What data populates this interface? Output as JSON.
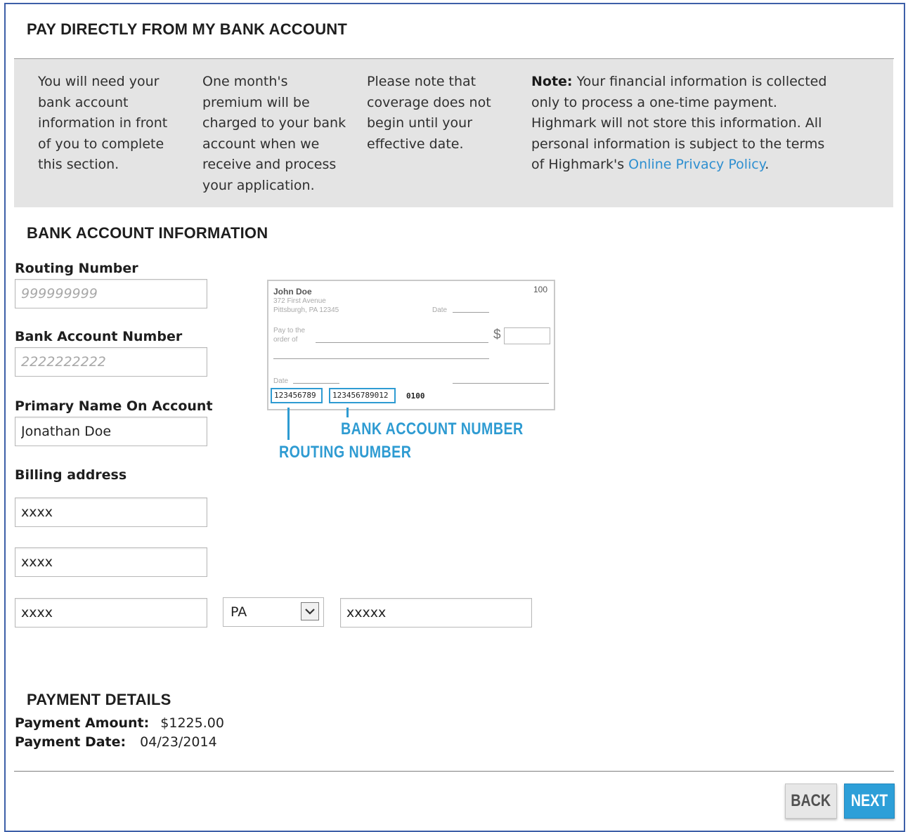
{
  "header": {
    "title": "PAY DIRECTLY FROM MY BANK ACCOUNT"
  },
  "info": {
    "col1": [
      "You will need your",
      "bank account",
      "information in front",
      "of you to complete",
      "this section."
    ],
    "col2": [
      "One month's",
      "premium will be",
      "charged to your bank",
      "account when we",
      "receive and process",
      "your application."
    ],
    "col3": [
      "Please note that",
      "coverage does not",
      "begin until your",
      "effective date."
    ],
    "note_label": "Note:",
    "note_line1": " Your financial information is collected",
    "note_lines": [
      "only to process a one-time payment.",
      "Highmark will not store this information. All",
      "personal information is subject to the terms"
    ],
    "note_last_prefix": "of Highmark's ",
    "privacy_link": "Online Privacy Policy",
    "note_last_suffix": "."
  },
  "bank": {
    "section_title": "BANK ACCOUNT INFORMATION",
    "routing_label": "Routing Number",
    "routing_placeholder": "999999999",
    "account_label": "Bank Account Number",
    "account_placeholder": "2222222222",
    "name_label": "Primary Name On Account",
    "name_value": "Jonathan Doe",
    "billing_label": "Billing address",
    "address1": "xxxx",
    "address2": "xxxx",
    "city": "xxxx",
    "state": "PA",
    "zip": "xxxxx"
  },
  "check": {
    "name": "John Doe",
    "street": "372 First Avenue",
    "city": "Pittsburgh, PA 12345",
    "number": "100",
    "date_label": "Date",
    "pay_to_1": "Pay to the",
    "pay_to_2": "order of",
    "dollar": "$",
    "memo_label": "Date",
    "routing_micr": "123456789",
    "account_micr": "123456789012",
    "check_micr": "0100",
    "callout_account": "BANK ACCOUNT NUMBER",
    "callout_routing": "ROUTING NUMBER"
  },
  "payment": {
    "section_title": "PAYMENT DETAILS",
    "amount_label": "Payment Amount:",
    "amount_value": "$1225.00",
    "date_label": "Payment Date:",
    "date_value": "04/23/2014"
  },
  "buttons": {
    "back": "BACK",
    "next": "NEXT"
  },
  "colors": {
    "accent": "#2e9bd2",
    "panel": "#e4e4e4",
    "border": "#3d5fa8"
  }
}
